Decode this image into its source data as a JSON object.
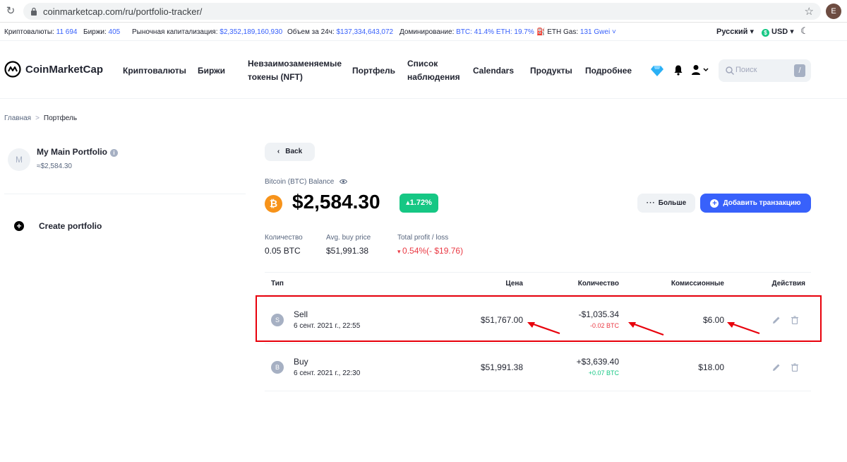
{
  "browser": {
    "url": "coinmarketcap.com/ru/portfolio-tracker/",
    "profile_initial": "E"
  },
  "stats": {
    "cryptos_label": "Криптовалюты:",
    "cryptos_value": "11 694",
    "exchanges_label": "Биржи:",
    "exchanges_value": "405",
    "market_cap_label": "Рыночная капитализация:",
    "market_cap_value": "$2,352,189,160,930",
    "volume_label": "Объем за 24ч:",
    "volume_value": "$137,334,643,072",
    "dominance_label": "Доминирование:",
    "dominance_value": "BTC: 41.4% ETH: 19.7%",
    "gas_label": "ETH Gas:",
    "gas_value": "131 Gwei",
    "language": "Русский",
    "currency": "USD"
  },
  "header": {
    "logo_text": "CoinMarketCap",
    "nav": {
      "cryptocurrencies": "Криптовалюты",
      "exchanges": "Биржи",
      "nft_line1": "Невзаимозаменяемые",
      "nft_line2": "токены (NFT)",
      "portfolio": "Портфель",
      "watchlist_line1": "Список",
      "watchlist_line2": "наблюдения",
      "calendars": "Calendars",
      "products": "Продукты",
      "learn": "Подробнее"
    },
    "search_placeholder": "Поиск",
    "search_shortcut": "/"
  },
  "breadcrumb": {
    "home": "Главная",
    "current": "Портфель"
  },
  "sidebar": {
    "portfolio_initial": "M",
    "portfolio_name": "My Main Portfolio",
    "portfolio_value": "≈$2,584.30",
    "create_label": "Create portfolio"
  },
  "main": {
    "back_label": "Back",
    "balance_label": "Bitcoin (BTC) Balance",
    "coin_symbol_glyph": "₿",
    "balance_value": "$2,584.30",
    "change_badge": "1.72%",
    "more_label": "Больше",
    "add_tx_label": "Добавить транзакцию",
    "metrics": {
      "quantity_label": "Количество",
      "quantity_value": "0.05 BTC",
      "avg_buy_label": "Avg. buy price",
      "avg_buy_value": "$51,991.38",
      "profit_label": "Total profit / loss",
      "profit_value": "0.54%(- $19.76)"
    }
  },
  "table": {
    "headers": {
      "type": "Тип",
      "price": "Цена",
      "quantity": "Количество",
      "fees": "Комиссионные",
      "actions": "Действия"
    },
    "rows": [
      {
        "initial": "S",
        "type": "Sell",
        "date": "6 сент. 2021 г., 22:55",
        "price": "$51,767.00",
        "amount": "-$1,035.34",
        "qty": "-0.02 BTC",
        "fee": "$6.00"
      },
      {
        "initial": "B",
        "type": "Buy",
        "date": "6 сент. 2021 г., 22:30",
        "price": "$51,991.38",
        "amount": "+$3,639.40",
        "qty": "+0.07 BTC",
        "fee": "$18.00"
      }
    ]
  },
  "colors": {
    "accent": "#3861fb",
    "positive": "#16c784",
    "negative": "#ea3943",
    "annotation": "#e8000b",
    "btc": "#f7931a"
  }
}
